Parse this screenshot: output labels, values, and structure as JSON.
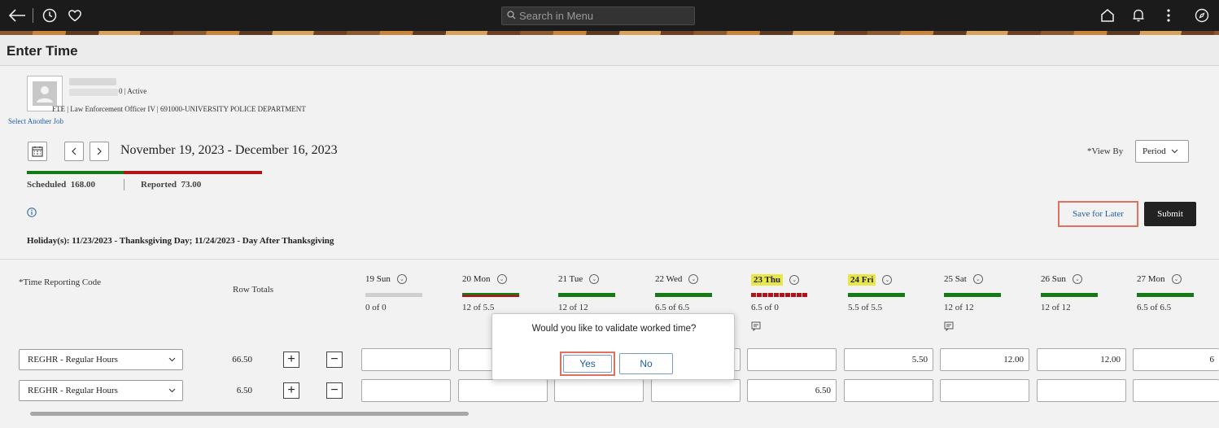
{
  "header": {
    "search_placeholder": "Search in Menu",
    "icons": [
      "back-arrow-icon",
      "history-icon",
      "favorites-heart-icon",
      "home-icon",
      "notifications-bell-icon",
      "more-vertical-icon",
      "navbar-compass-icon"
    ]
  },
  "page": {
    "title": "Enter Time"
  },
  "employee": {
    "status": "0 | Active",
    "job": "FTE | Law Enforcement Officer IV | 691000-UNIVERSITY POLICE DEPARTMENT",
    "select_another_job": "Select Another Job"
  },
  "period": {
    "date_range": "November 19, 2023 - December 16, 2023",
    "scheduled": "Scheduled  168.00",
    "reported": "Reported  73.00"
  },
  "view_by": {
    "label": "*View By",
    "value": "Period"
  },
  "actions": {
    "save_for_later": "Save for Later",
    "submit": "Submit"
  },
  "holiday_text": "Holiday(s): 11/23/2023 - Thanksgiving Day; 11/24/2023 - Day After Thanksgiving",
  "grid": {
    "trc_header": "*Time Reporting Code",
    "row_totals_header": "Row Totals",
    "days": [
      {
        "label": "19 Sun",
        "hours": "0 of 0",
        "highlight": false,
        "bar": "gray",
        "comment": false
      },
      {
        "label": "20 Mon",
        "hours": "12 of 5.5",
        "highlight": false,
        "bar": "green-red",
        "comment": false
      },
      {
        "label": "21 Tue",
        "hours": "12 of 12",
        "highlight": false,
        "bar": "green",
        "comment": false
      },
      {
        "label": "22 Wed",
        "hours": "6.5 of 6.5",
        "highlight": false,
        "bar": "green",
        "comment": false
      },
      {
        "label": "23 Thu",
        "hours": "6.5 of 0",
        "highlight": true,
        "bar": "red",
        "comment": true
      },
      {
        "label": "24 Fri",
        "hours": "5.5 of 5.5",
        "highlight": true,
        "bar": "green",
        "comment": false
      },
      {
        "label": "25 Sat",
        "hours": "12 of 12",
        "highlight": false,
        "bar": "green",
        "comment": true
      },
      {
        "label": "26 Sun",
        "hours": "12 of 12",
        "highlight": false,
        "bar": "green",
        "comment": false
      },
      {
        "label": "27 Mon",
        "hours": "6.5 of 6.5",
        "highlight": false,
        "bar": "green",
        "comment": false
      }
    ],
    "rows": [
      {
        "trc": "REGHR - Regular Hours",
        "total": "66.50",
        "cells": [
          "",
          "",
          "",
          "",
          "",
          "5.50",
          "12.00",
          "12.00",
          "6"
        ]
      },
      {
        "trc": "REGHR - Regular Hours",
        "total": "6.50",
        "cells": [
          "",
          "",
          "",
          "",
          "6.50",
          "",
          "",
          "",
          ""
        ]
      }
    ]
  },
  "dialog": {
    "message": "Would you like to validate worked time?",
    "yes": "Yes",
    "no": "No"
  },
  "colors": {
    "scheduled_bar": "#147a14",
    "reported_bar": "#b0141a",
    "highlight": "#e8e64b",
    "focus_outline": "#e07060",
    "link": "#1f5fa5"
  }
}
